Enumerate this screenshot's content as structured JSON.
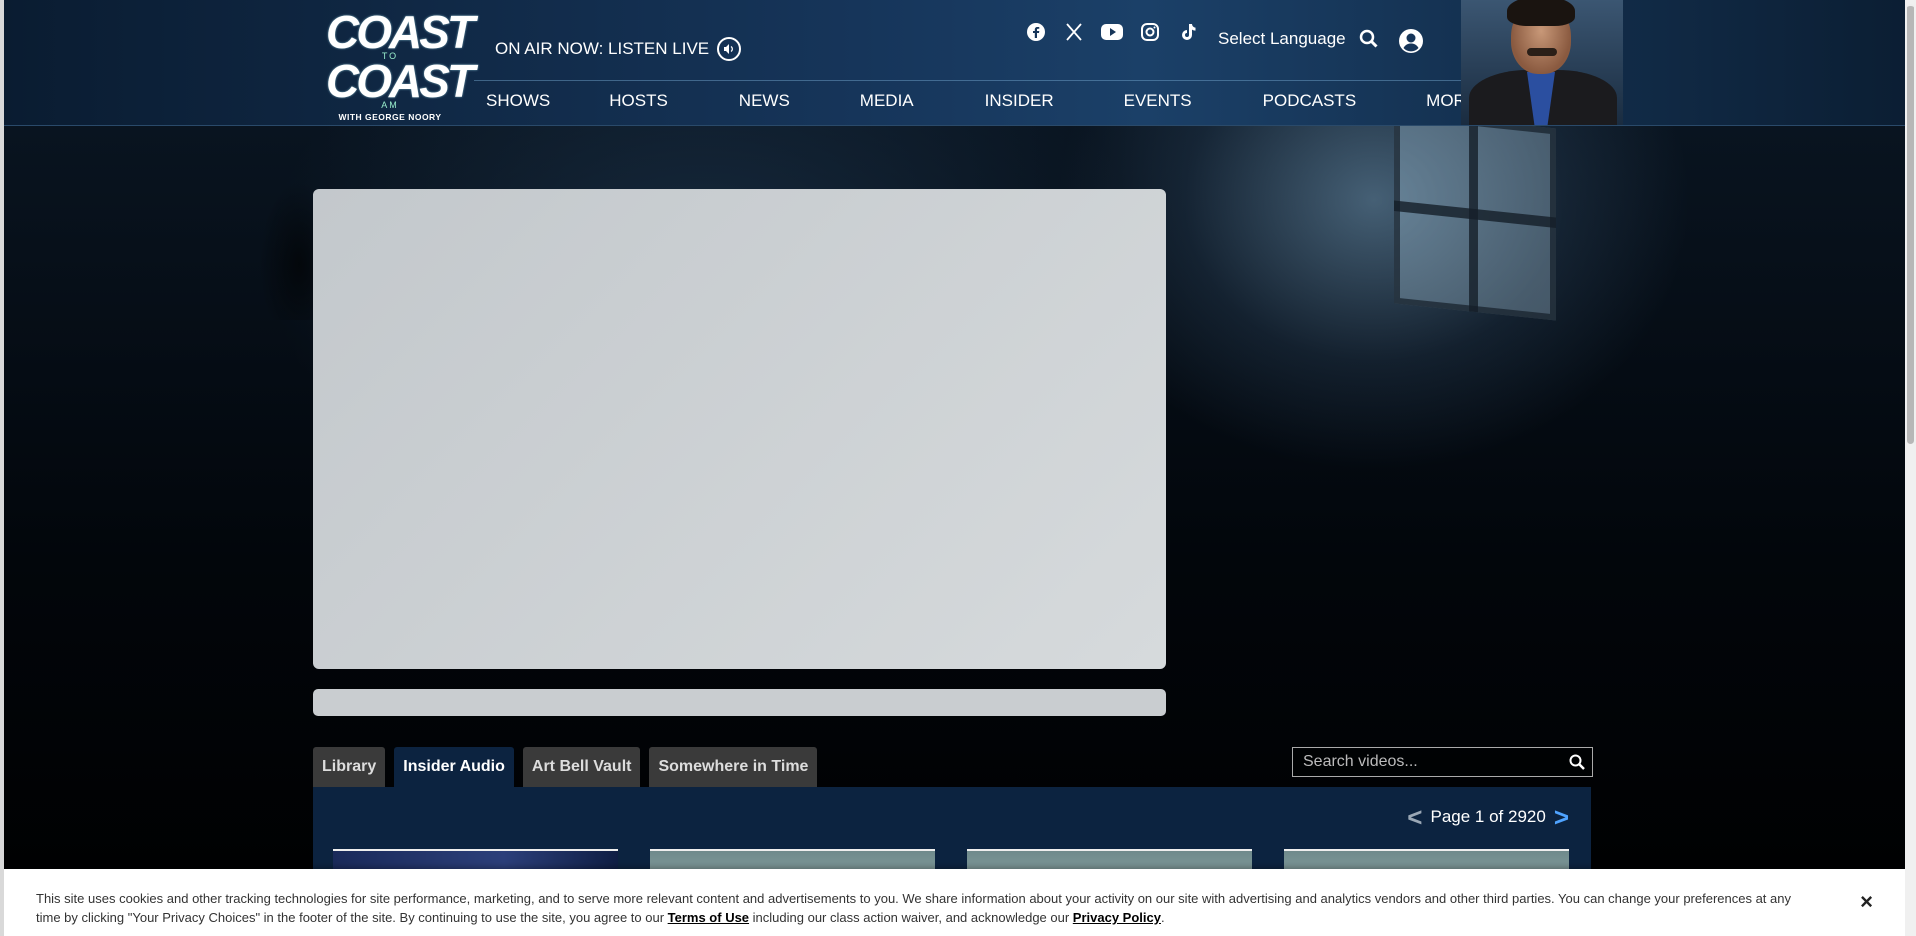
{
  "header": {
    "logo": {
      "line1": "COAST",
      "to": "TO",
      "line2": "COAST",
      "am": "AM",
      "sub": "WITH GEORGE NOORY"
    },
    "on_air_label": "ON AIR NOW: LISTEN LIVE",
    "socials": [
      {
        "name": "facebook-icon",
        "glyph": "f"
      },
      {
        "name": "x-icon",
        "glyph": "𝕏"
      },
      {
        "name": "youtube-icon",
        "glyph": "▶"
      },
      {
        "name": "instagram-icon",
        "glyph": "◎"
      },
      {
        "name": "tiktok-icon",
        "glyph": "♪"
      }
    ],
    "language_label": "Select Language",
    "nav": [
      "SHOWS",
      "HOSTS",
      "NEWS",
      "MEDIA",
      "INSIDER",
      "EVENTS",
      "PODCASTS",
      "MORE"
    ]
  },
  "tabs": [
    {
      "label": "Library",
      "active": false
    },
    {
      "label": "Insider Audio",
      "active": true
    },
    {
      "label": "Art Bell Vault",
      "active": false
    },
    {
      "label": "Somewhere in Time",
      "active": false
    }
  ],
  "video_search": {
    "placeholder": "Search videos..."
  },
  "pager": {
    "text": "Page 1 of 2920"
  },
  "cookie": {
    "text_before_terms": "This site uses cookies and other tracking technologies for site performance, marketing, and to serve more relevant content and advertisements to you. We share information about your activity on our site with advertising and analytics vendors and other third parties. You can change your preferences at any time by clicking \"Your Privacy Choices\" in the footer of the site. By continuing to use the site, you agree to our ",
    "terms_link": "Terms of Use",
    "text_between": " including our class action waiver, and acknowledge our ",
    "privacy_link": "Privacy Policy",
    "text_end": ".",
    "close_glyph": "×"
  },
  "colors": {
    "header_bg": "#16355a",
    "active_tab": "#0c2340",
    "next_arrow": "#4fa3ff"
  }
}
